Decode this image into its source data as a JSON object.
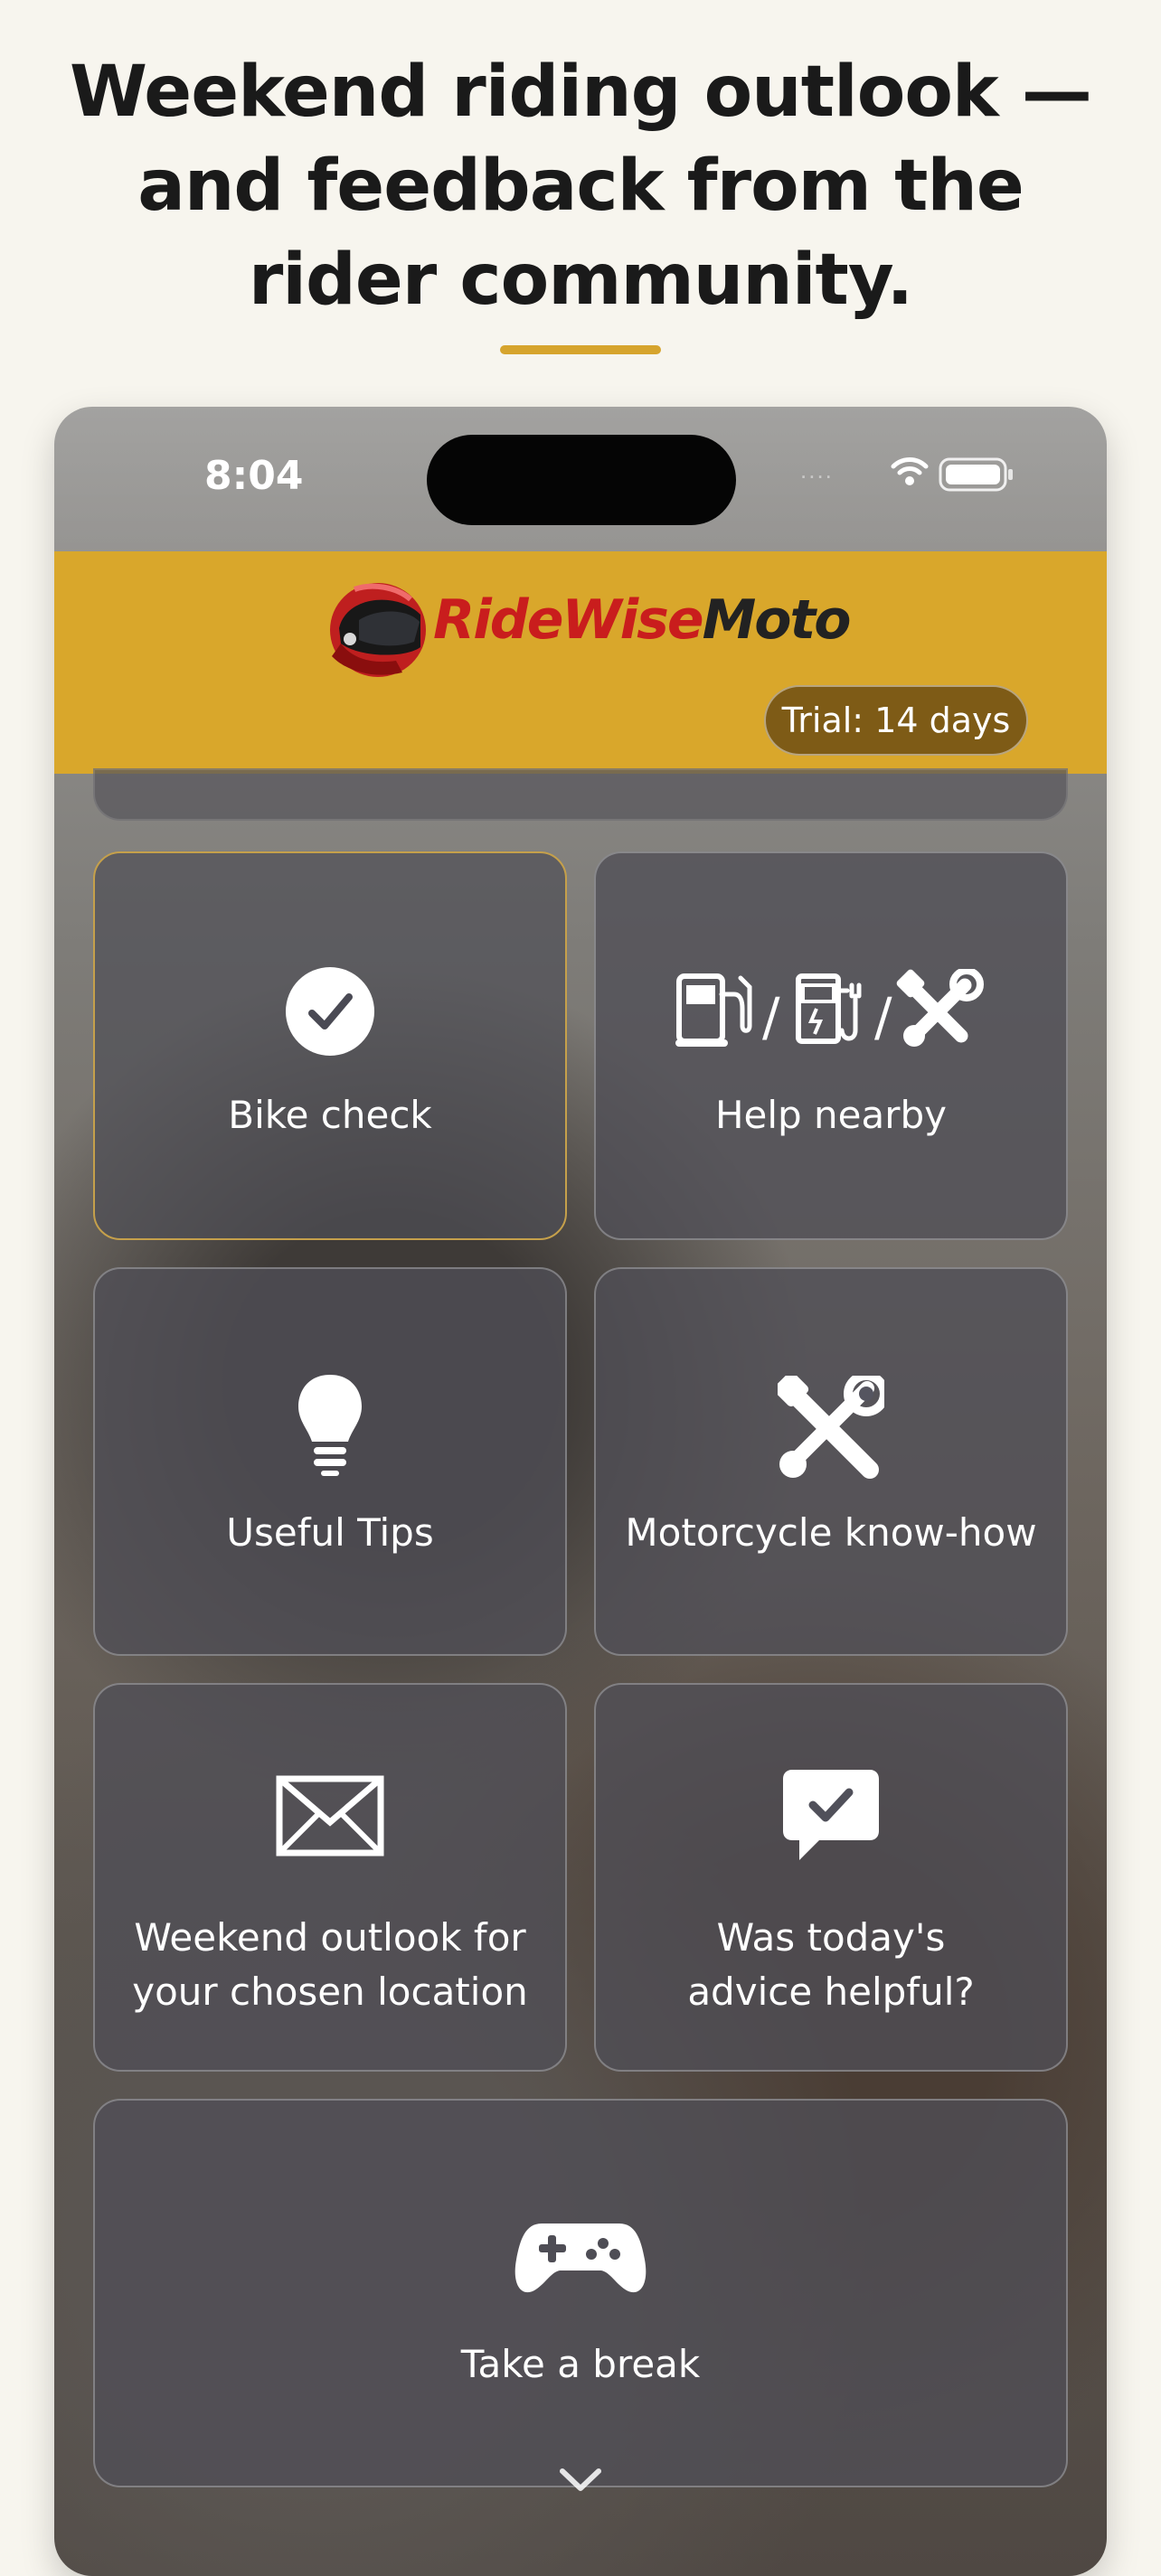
{
  "headline": {
    "line1": "Weekend riding outlook —",
    "line2": "and feedback from the",
    "line3": "rider community."
  },
  "status_bar": {
    "time": "8:04",
    "signal": "....",
    "wifi_icon": "wifi-icon",
    "battery_icon": "battery-icon"
  },
  "app_header": {
    "logo_part1": "RideWise",
    "logo_part2": "Moto",
    "trial_badge": "Trial: 14 days",
    "colors": {
      "header_bg": "#d9a72b",
      "logo_red": "#c91d1d",
      "trial_bg": "#7e5b16"
    }
  },
  "tiles": [
    {
      "label": "Bike check",
      "icon": "checkmark-circle-icon"
    },
    {
      "label": "Help nearby",
      "icon": "fuel-charger-tools-icon",
      "icon_separator": "/"
    },
    {
      "label": "Useful Tips",
      "icon": "lightbulb-icon"
    },
    {
      "label": "Motorcycle know-how",
      "icon": "tools-icon"
    },
    {
      "label_line1": "Weekend outlook for",
      "label_line2": "your chosen location",
      "icon": "mail-icon"
    },
    {
      "label_line1": "Was today's",
      "label_line2": "advice helpful?",
      "icon": "chat-check-icon"
    },
    {
      "label": "Take a break",
      "icon": "gamepad-icon"
    }
  ],
  "scroll_indicator": "chevron-down-icon"
}
